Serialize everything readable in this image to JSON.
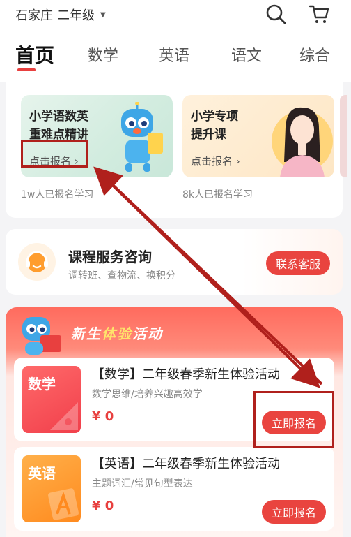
{
  "header": {
    "city": "石家庄",
    "grade": "二年级",
    "search_icon": "search-icon",
    "cart_icon": "cart-icon"
  },
  "tabs": [
    {
      "label": "首页",
      "active": true
    },
    {
      "label": "数学"
    },
    {
      "label": "英语"
    },
    {
      "label": "语文"
    },
    {
      "label": "综合"
    }
  ],
  "promos": [
    {
      "title": "小学语数英\n重难点精讲",
      "cta": "点击报名",
      "footer": "1w人已报名学习"
    },
    {
      "title": "小学专项\n提升课",
      "cta": "点击报名",
      "footer": "8k人已报名学习"
    }
  ],
  "service": {
    "title": "课程服务咨询",
    "subtitle": "调转班、查物流、换积分",
    "button": "联系客服"
  },
  "activity": {
    "title_part1": "新生",
    "title_part2": "体验",
    "title_part3": "活动",
    "courses": [
      {
        "tag": "数学",
        "title": "【数学】二年级春季新生体验活动",
        "subtitle": "数学思维/培养兴趣高效学",
        "price": "¥ 0",
        "button": "立即报名"
      },
      {
        "tag": "英语",
        "title": "【英语】二年级春季新生体验活动",
        "subtitle": "主题词汇/常见句型表达",
        "price": "¥ 0",
        "button": "立即报名"
      }
    ]
  },
  "colors": {
    "accent": "#e9443f",
    "annotation": "#b0201c"
  }
}
